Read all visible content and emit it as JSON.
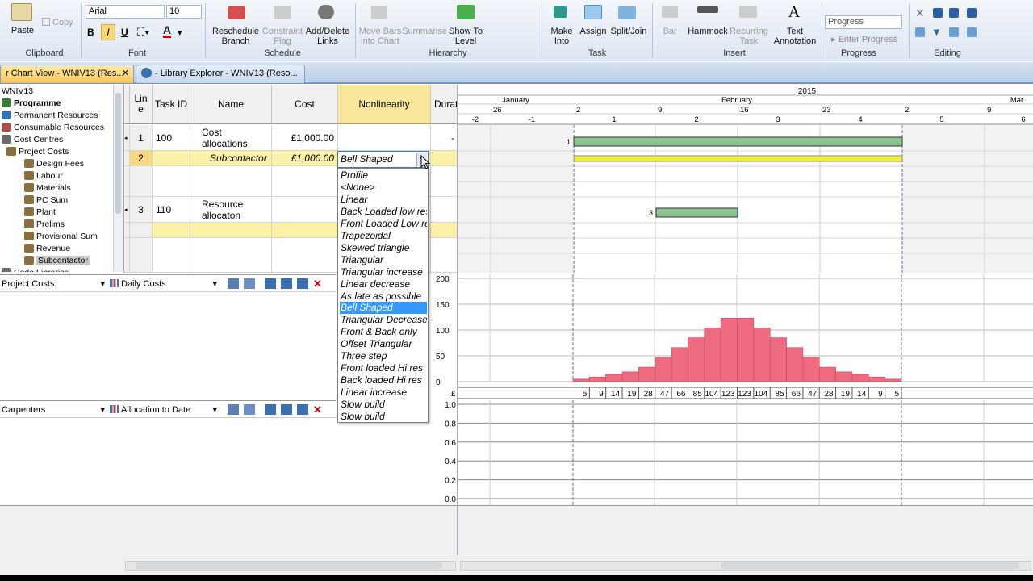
{
  "ribbon": {
    "clipboard": {
      "paste": "Paste",
      "copy": "Copy",
      "label": "Clipboard"
    },
    "font": {
      "name": "Arial",
      "size": "10",
      "bold": "B",
      "italic": "I",
      "underline": "U",
      "color_letter": "A",
      "label": "Font"
    },
    "schedule": {
      "reschedule": "Reschedule\nBranch",
      "constraint": "Constraint\nFlag",
      "add_delete": "Add/Delete\nLinks",
      "label": "Schedule"
    },
    "hierarchy": {
      "move_bars": "Move Bars\ninto Chart",
      "summarise": "Summarise",
      "show_to": "Show To\nLevel",
      "label": "Hierarchy"
    },
    "task": {
      "make_into": "Make\nInto",
      "assign": "Assign",
      "split_join": "Split/Join",
      "label": "Task"
    },
    "insert": {
      "bar": "Bar",
      "hammock": "Hammock",
      "recurring": "Recurring\nTask",
      "text_annotation": "Text\nAnnotation",
      "label": "Insert"
    },
    "progress": {
      "combo": "Progress",
      "enter_progress": "Enter Progress",
      "label": "Progress"
    },
    "editing": {
      "label": "Editing"
    }
  },
  "tabs": [
    {
      "label": "r Chart View - WNIV13 (Res...",
      "close": "✕"
    },
    {
      "label": "- Library Explorer - WNIV13 (Reso...",
      "close": "✕"
    }
  ],
  "tree": {
    "root": "WNIV13",
    "items": [
      {
        "label": "Programme",
        "bold": true,
        "color": "#3a7a3a"
      },
      {
        "label": "Permanent Resources",
        "bold": false,
        "color": "#3a6fb0"
      },
      {
        "label": "Consumable Resources",
        "bold": false,
        "color": "#b04a4a"
      },
      {
        "label": "Cost Centres",
        "bold": false,
        "color": "#6a6a6a"
      },
      {
        "label": "Project Costs",
        "bold": false,
        "color": "#8a7040"
      },
      {
        "label": "Design Fees",
        "bold": false,
        "color": "#8a7040"
      },
      {
        "label": "Labour",
        "bold": false,
        "color": "#8a7040"
      },
      {
        "label": "Materials",
        "bold": false,
        "color": "#8a7040"
      },
      {
        "label": "PC Sum",
        "bold": false,
        "color": "#8a7040"
      },
      {
        "label": "Plant",
        "bold": false,
        "color": "#8a7040"
      },
      {
        "label": "Prelims",
        "bold": false,
        "color": "#8a7040"
      },
      {
        "label": "Provisional Sum",
        "bold": false,
        "color": "#8a7040"
      },
      {
        "label": "Revenue",
        "bold": false,
        "color": "#8a7040"
      },
      {
        "label": "Subcontactor",
        "bold": false,
        "color": "#8a7040",
        "selected": true
      },
      {
        "label": "Code Libraries",
        "bold": false,
        "color": "#6a6a6a"
      }
    ]
  },
  "grid": {
    "headers": {
      "line": "Lin\ne",
      "task_id": "Task ID",
      "name": "Name",
      "cost": "Cost",
      "nonlinearity": "Nonlinearity",
      "duration": "Durat"
    },
    "rows": [
      {
        "line": "1",
        "task_id": "100",
        "name": "Cost\nallocations",
        "cost": "£1,000.00",
        "nonlin": "",
        "dur": "-"
      },
      {
        "line": "2",
        "task_id": "",
        "name": "Subcontactor",
        "cost": "£1,000.00",
        "nonlin": "Bell Shaped",
        "dur": ""
      },
      {
        "line": "",
        "task_id": "",
        "name": "",
        "cost": "",
        "nonlin": "",
        "dur": ""
      },
      {
        "line": "3",
        "task_id": "110",
        "name": "Resource\nallocaton",
        "cost": "",
        "nonlin": "",
        "dur": ""
      },
      {
        "line": "",
        "task_id": "",
        "name": "",
        "cost": "",
        "nonlin": "",
        "dur": ""
      },
      {
        "line": "",
        "task_id": "",
        "name": "",
        "cost": "",
        "nonlin": "",
        "dur": ""
      }
    ]
  },
  "dropdown": {
    "selected": "Bell Shaped",
    "options": [
      "Profile",
      "<None>",
      "Linear",
      "Back Loaded low res",
      "Front Loaded Low res",
      "Trapezoidal",
      "Skewed triangle",
      "Triangular",
      "Triangular increase",
      "Linear decrease",
      "As late as possible",
      "Bell Shaped",
      "Triangular Decrease",
      "Front & Back only",
      "Offset Triangular",
      "Three step",
      "Front loaded Hi res",
      "Back loaded Hi res",
      "Linear increase",
      "Slow build",
      "Slow build"
    ]
  },
  "timeline": {
    "year": "2015",
    "months": [
      "January",
      "February",
      "Mar"
    ],
    "days": [
      "26",
      "2",
      "9",
      "16",
      "23",
      "2",
      "9"
    ],
    "weeks": [
      "-2",
      "-1",
      "1",
      "2",
      "3",
      "4",
      "5",
      "6"
    ]
  },
  "gantt_labels": {
    "bar1": "1",
    "bar3": "3"
  },
  "colors": {
    "green_bar": "#8dc48d",
    "yellow_bar": "#f0f030",
    "hist_bar": "#ee6b80",
    "accent": "#3399ff"
  },
  "panel1": {
    "left_select": "Project Costs",
    "right_select": "Daily Costs"
  },
  "panel2": {
    "left_select": "Carpenters",
    "right_select": "Allocation to Date"
  },
  "chart_data": [
    {
      "type": "bar",
      "title": "",
      "ylim": [
        0,
        200
      ],
      "yticks": [
        "200",
        "150",
        "100",
        "50",
        "0"
      ],
      "currency_label": "£",
      "values": [
        5,
        9,
        14,
        19,
        28,
        47,
        66,
        85,
        104,
        123,
        123,
        104,
        85,
        66,
        47,
        28,
        19,
        14,
        9,
        5
      ],
      "value_labels": [
        "5",
        "9",
        "14",
        "19",
        "28",
        "47",
        "66",
        "85",
        "104",
        "123",
        "123",
        "104",
        "85",
        "66",
        "47",
        "28",
        "19",
        "14",
        "9",
        "5"
      ]
    },
    {
      "type": "line",
      "title": "",
      "ylim": [
        0,
        1
      ],
      "yticks": [
        "1.0",
        "0.8",
        "0.6",
        "0.4",
        "0.2",
        "0.0"
      ],
      "values": []
    }
  ]
}
